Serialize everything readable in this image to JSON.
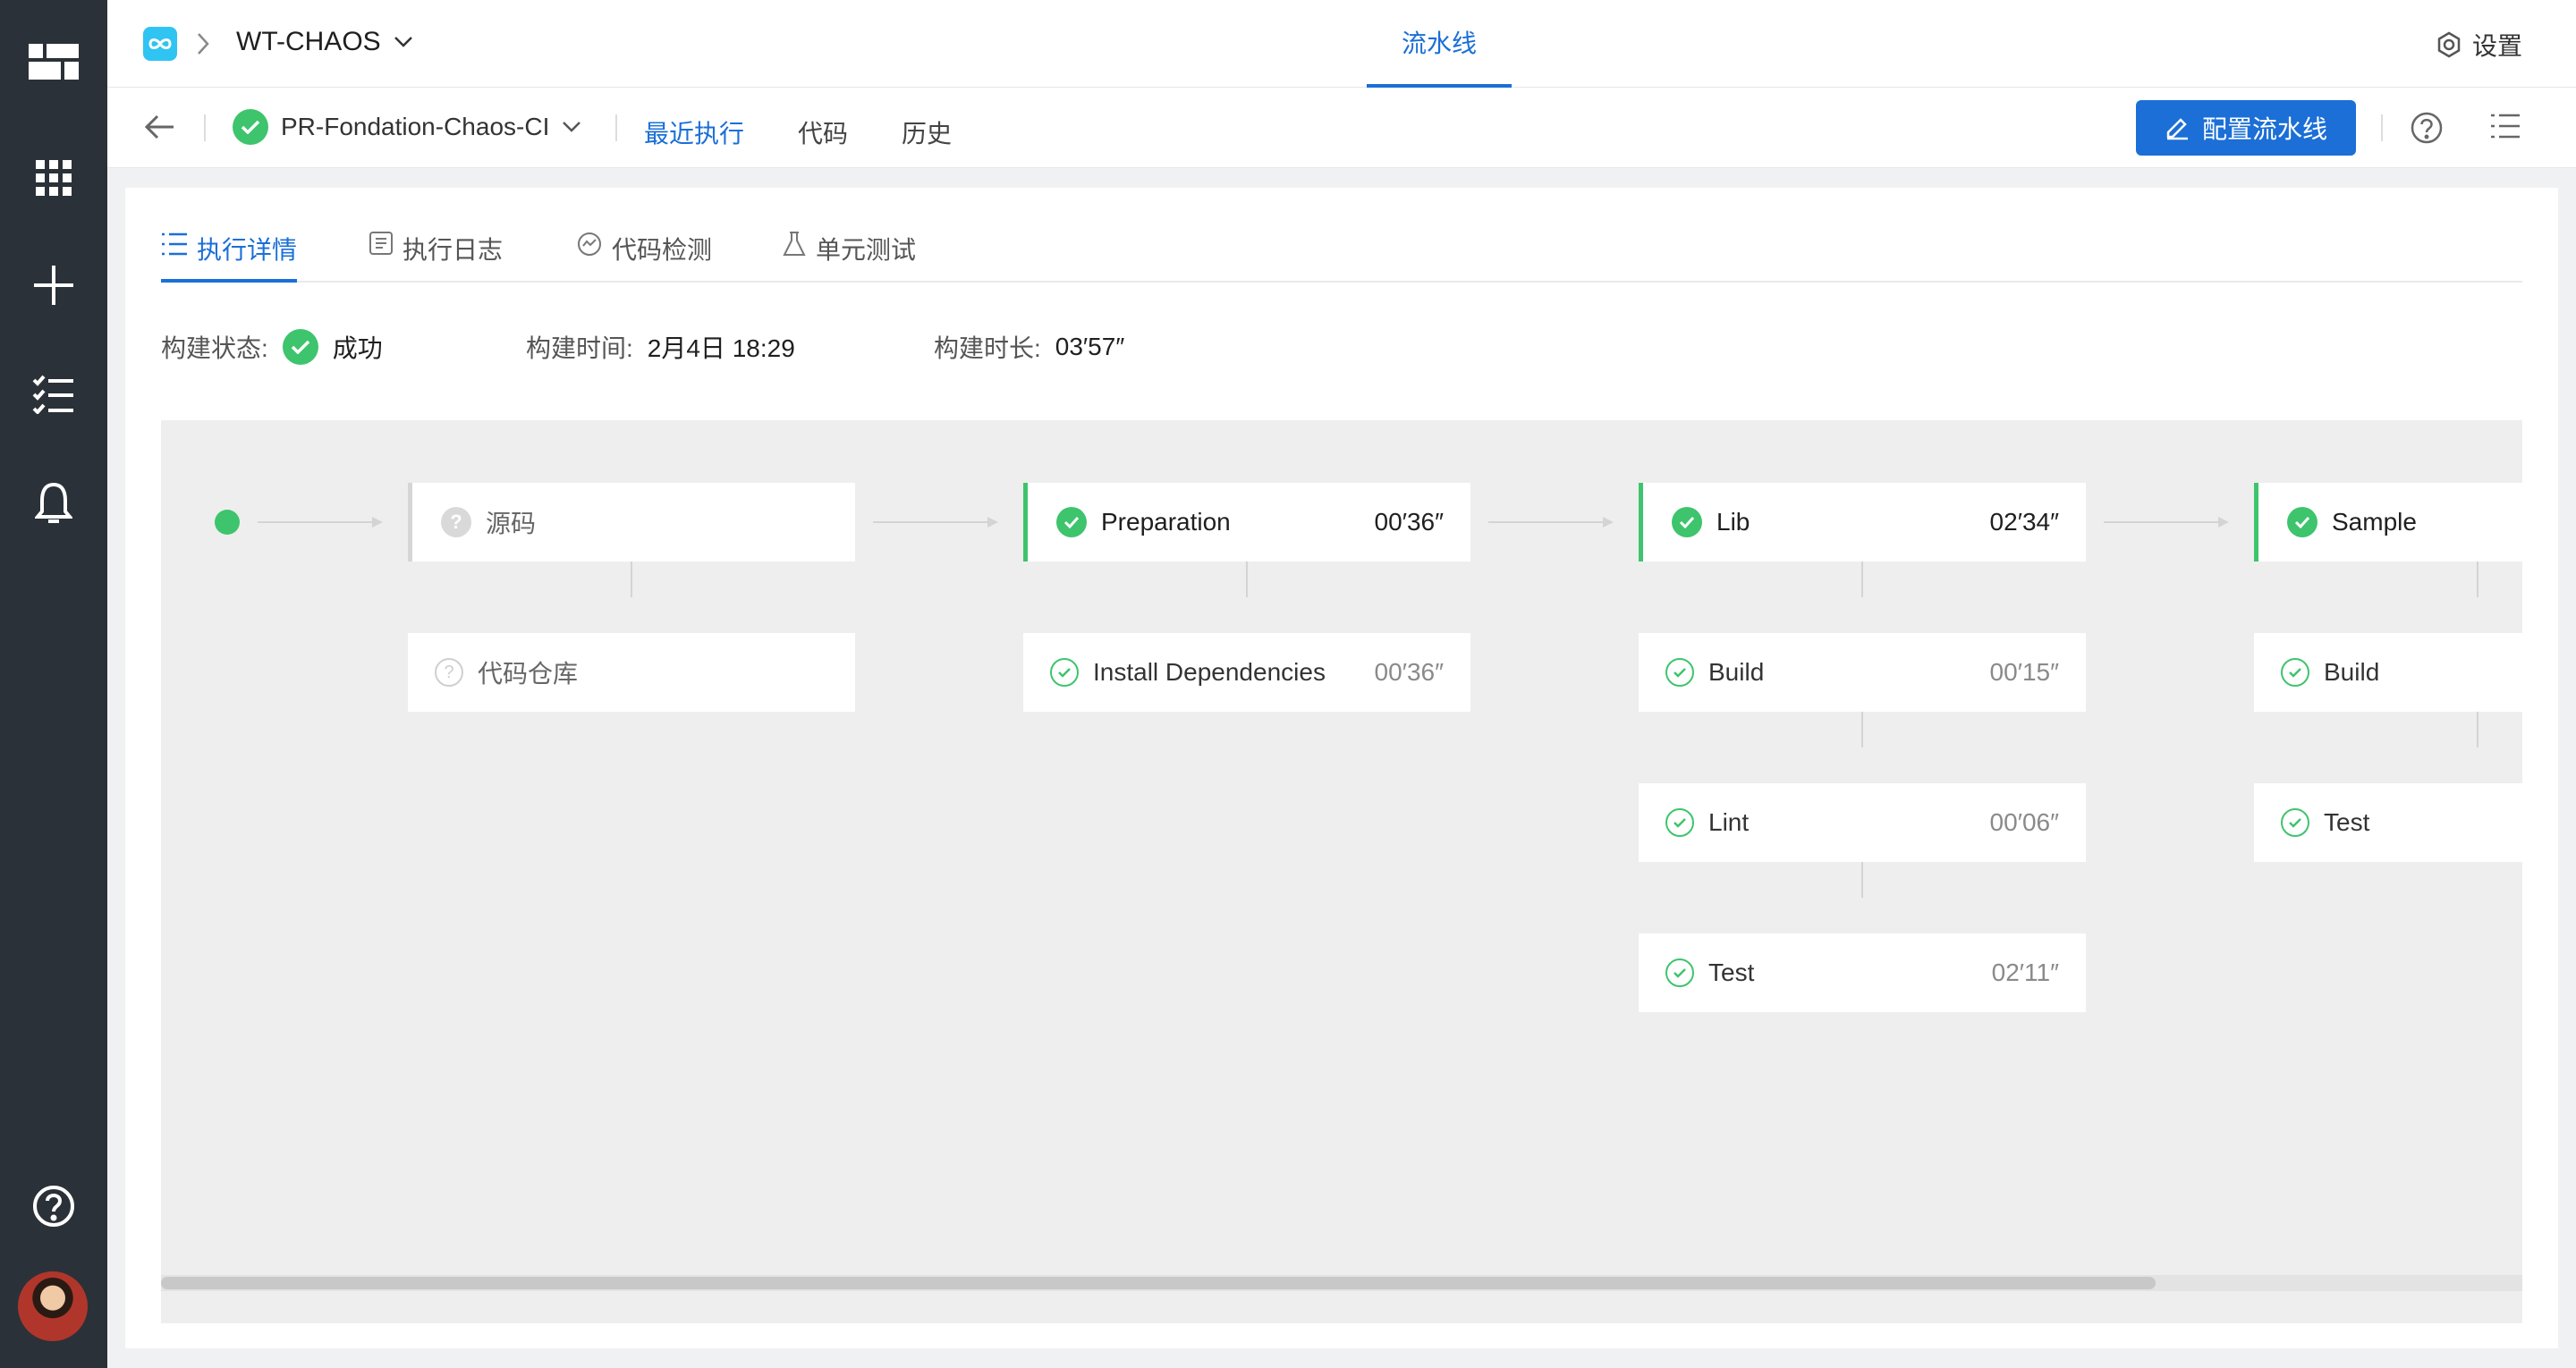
{
  "header": {
    "project_name": "WT-CHAOS",
    "center_tab": "流水线",
    "settings_label": "设置"
  },
  "subbar": {
    "pipeline_name": "PR-Fondation-Chaos-CI",
    "links": [
      "最近执行",
      "代码",
      "历史"
    ],
    "config_button": "配置流水线"
  },
  "tabs": [
    "执行详情",
    "执行日志",
    "代码检测",
    "单元测试"
  ],
  "build": {
    "status_label": "构建状态:",
    "status_value": "成功",
    "time_label": "构建时间:",
    "time_value": "2月4日 18:29",
    "duration_label": "构建时长:",
    "duration_value": "03′57″"
  },
  "pipeline": {
    "stages": [
      {
        "name": "源码",
        "duration": "",
        "status": "pending",
        "jobs": [
          {
            "name": "代码仓库",
            "duration": "",
            "status": "pending"
          }
        ]
      },
      {
        "name": "Preparation",
        "duration": "00′36″",
        "status": "success",
        "jobs": [
          {
            "name": "Install Dependencies",
            "duration": "00′36″",
            "status": "success"
          }
        ]
      },
      {
        "name": "Lib",
        "duration": "02′34″",
        "status": "success",
        "jobs": [
          {
            "name": "Build",
            "duration": "00′15″",
            "status": "success"
          },
          {
            "name": "Lint",
            "duration": "00′06″",
            "status": "success"
          },
          {
            "name": "Test",
            "duration": "02′11″",
            "status": "success"
          }
        ]
      },
      {
        "name": "Sample",
        "duration": "",
        "status": "success",
        "jobs": [
          {
            "name": "Build",
            "duration": "",
            "status": "success"
          },
          {
            "name": "Test",
            "duration": "",
            "status": "success"
          }
        ]
      }
    ]
  },
  "colors": {
    "rail": "#2b3138",
    "accent": "#1b6fd6",
    "success": "#3ec46d",
    "canvas": "#eeeeee"
  }
}
